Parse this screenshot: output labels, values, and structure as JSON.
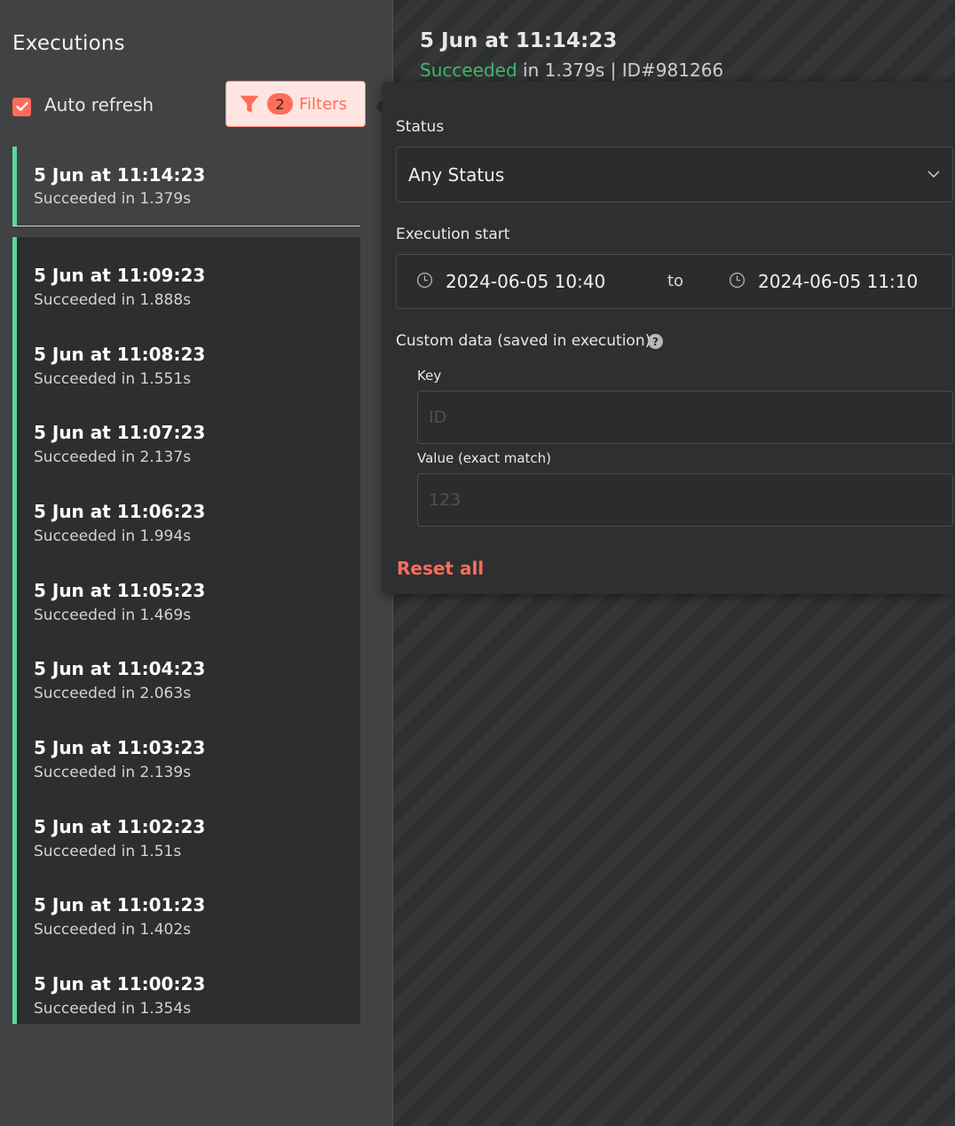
{
  "sidebar": {
    "title": "Executions",
    "auto_refresh_label": "Auto refresh",
    "auto_refresh_checked": true,
    "filters_count": "2",
    "filters_label": "Filters",
    "selected": {
      "title": "5 Jun at 11:14:23",
      "subtitle": "Succeeded in 1.379s"
    },
    "items": [
      {
        "title": "5 Jun at 11:09:23",
        "subtitle": "Succeeded in 1.888s"
      },
      {
        "title": "5 Jun at 11:08:23",
        "subtitle": "Succeeded in 1.551s"
      },
      {
        "title": "5 Jun at 11:07:23",
        "subtitle": "Succeeded in 2.137s"
      },
      {
        "title": "5 Jun at 11:06:23",
        "subtitle": "Succeeded in 1.994s"
      },
      {
        "title": "5 Jun at 11:05:23",
        "subtitle": "Succeeded in 1.469s"
      },
      {
        "title": "5 Jun at 11:04:23",
        "subtitle": "Succeeded in 2.063s"
      },
      {
        "title": "5 Jun at 11:03:23",
        "subtitle": "Succeeded in 2.139s"
      },
      {
        "title": "5 Jun at 11:02:23",
        "subtitle": "Succeeded in 1.51s"
      },
      {
        "title": "5 Jun at 11:01:23",
        "subtitle": "Succeeded in 1.402s"
      },
      {
        "title": "5 Jun at 11:00:23",
        "subtitle": "Succeeded in 1.354s"
      }
    ]
  },
  "main": {
    "title": "5 Jun at 11:14:23",
    "status": "Succeeded",
    "duration_text": " in 1.379s | ID#981266"
  },
  "filter": {
    "status_label": "Status",
    "status_value": "Any Status",
    "execution_start_label": "Execution start",
    "start_from": "2024-06-05 10:40",
    "to_label": "to",
    "start_to": "2024-06-05 11:10",
    "custom_data_label": "Custom data (saved in execution)",
    "help_glyph": "?",
    "key_label": "Key",
    "key_placeholder": "ID",
    "value_label": "Value (exact match)",
    "value_placeholder": "123",
    "reset_label": "Reset all"
  },
  "colors": {
    "accent": "#ff6d5a",
    "success": "#3fba6c",
    "success_bar": "#5ad89b"
  },
  "icons": [
    "check-icon",
    "filter-icon",
    "chevron-down-icon",
    "clock-icon",
    "help-icon"
  ]
}
